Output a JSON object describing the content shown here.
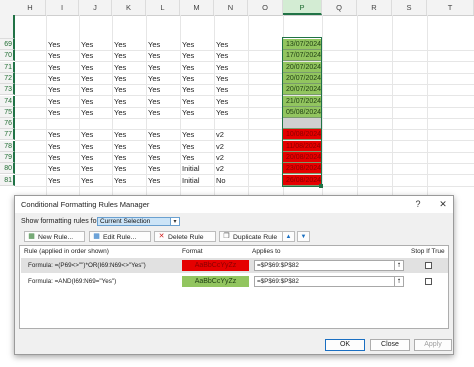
{
  "spreadsheet": {
    "columns": [
      "H",
      "I",
      "J",
      "K",
      "L",
      "M",
      "N",
      "O",
      "P",
      "Q",
      "R",
      "S",
      "T"
    ],
    "selected_column": "P",
    "rows": [
      {
        "num": "69",
        "I": "Yes",
        "J": "Yes",
        "K": "Yes",
        "L": "Yes",
        "M": "Yes",
        "N": "Yes",
        "P": "13/07/2024",
        "status": "green"
      },
      {
        "num": "70",
        "I": "Yes",
        "J": "Yes",
        "K": "Yes",
        "L": "Yes",
        "M": "Yes",
        "N": "Yes",
        "P": "17/07/2024",
        "status": "green"
      },
      {
        "num": "71",
        "I": "Yes",
        "J": "Yes",
        "K": "Yes",
        "L": "Yes",
        "M": "Yes",
        "N": "Yes",
        "P": "20/07/2024",
        "status": "green"
      },
      {
        "num": "72",
        "I": "Yes",
        "J": "Yes",
        "K": "Yes",
        "L": "Yes",
        "M": "Yes",
        "N": "Yes",
        "P": "20/07/2024",
        "status": "green"
      },
      {
        "num": "73",
        "I": "Yes",
        "J": "Yes",
        "K": "Yes",
        "L": "Yes",
        "M": "Yes",
        "N": "Yes",
        "P": "20/07/2024",
        "status": "green"
      },
      {
        "num": "74",
        "I": "Yes",
        "J": "Yes",
        "K": "Yes",
        "L": "Yes",
        "M": "Yes",
        "N": "Yes",
        "P": "21/07/2024",
        "status": "green"
      },
      {
        "num": "75",
        "I": "Yes",
        "J": "Yes",
        "K": "Yes",
        "L": "Yes",
        "M": "Yes",
        "N": "Yes",
        "P": "05/08/2024",
        "status": "green"
      },
      {
        "num": "76",
        "I": "",
        "J": "",
        "K": "",
        "L": "",
        "M": "",
        "N": "",
        "P": "",
        "status": "gray"
      },
      {
        "num": "77",
        "I": "Yes",
        "J": "Yes",
        "K": "Yes",
        "L": "Yes",
        "M": "Yes",
        "N": "v2",
        "P": "10/08/2024",
        "status": "red"
      },
      {
        "num": "78",
        "I": "Yes",
        "J": "Yes",
        "K": "Yes",
        "L": "Yes",
        "M": "Yes",
        "N": "v2",
        "P": "11/08/2024",
        "status": "red"
      },
      {
        "num": "79",
        "I": "Yes",
        "J": "Yes",
        "K": "Yes",
        "L": "Yes",
        "M": "Yes",
        "N": "v2",
        "P": "20/08/2024",
        "status": "red"
      },
      {
        "num": "80",
        "I": "Yes",
        "J": "Yes",
        "K": "Yes",
        "L": "Yes",
        "M": "Initial",
        "N": "v2",
        "P": "23/08/2024",
        "status": "red"
      },
      {
        "num": "81",
        "I": "Yes",
        "J": "Yes",
        "K": "Yes",
        "L": "Yes",
        "M": "Initial",
        "N": "No",
        "P": "26/08/2024",
        "status": "red"
      }
    ]
  },
  "dialog": {
    "title": "Conditional Formatting Rules Manager",
    "help": "?",
    "close": "✕",
    "show_rules_label": "Show formatting rules for:",
    "show_rules_value": "Current Selection",
    "toolbar": {
      "new_rule": "New Rule...",
      "edit_rule": "Edit Rule...",
      "delete_rule": "Delete Rule",
      "duplicate_rule": "Duplicate Rule"
    },
    "table_headers": {
      "rule": "Rule (applied in order shown)",
      "format": "Format",
      "applies_to": "Applies to",
      "stop_if_true": "Stop If True"
    },
    "rules": [
      {
        "rule": "Formula: =(P69<>\"\")*OR(I69:N69<>\"Yes\")",
        "format_preview": "AaBbCcYyZz",
        "format_color": "#e50000",
        "applies_to": "=$P$69:$P$82",
        "stop_if_true": false
      },
      {
        "rule": "Formula: =AND(I69:N69=\"Yes\")",
        "format_preview": "AaBbCcYyZz",
        "format_color": "#92c55f",
        "applies_to": "=$P$69:$P$82",
        "stop_if_true": false
      }
    ],
    "buttons": {
      "ok": "OK",
      "close": "Close",
      "apply": "Apply"
    }
  }
}
